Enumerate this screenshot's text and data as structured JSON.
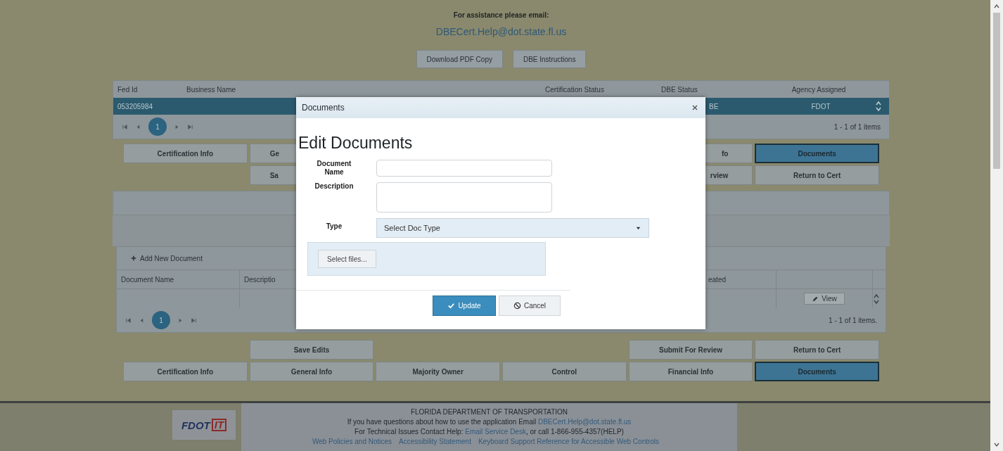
{
  "assistance": {
    "label": "For assistance please email:",
    "email": "DBECert.Help@dot.state.fl.us"
  },
  "top_buttons": [
    "Download PDF Copy",
    "DBE Instructions"
  ],
  "cert_grid": {
    "columns": [
      "Fed Id",
      "Business Name",
      "Certification Status",
      "DBE Status",
      "Agency Assigned"
    ],
    "rows": [
      {
        "fed_id": "053205984",
        "dbe_status": "BE",
        "agency": "FDOT",
        "selected": true
      }
    ],
    "pager": {
      "pages": [
        {
          "label": "1",
          "selected": true
        }
      ],
      "summary": "1 - 1 of 1 items"
    }
  },
  "top_tabs": {
    "left": [
      {
        "label": "Certification Info",
        "selected": false
      },
      {
        "label": "Ge",
        "selected": false
      }
    ],
    "right": [
      {
        "label": "fo",
        "selected": false
      },
      {
        "label": "Documents",
        "selected": true
      }
    ]
  },
  "top_actions": {
    "left": [
      {
        "label": "Sa"
      }
    ],
    "right": [
      {
        "label": "rview"
      },
      {
        "label": "Return to Cert"
      }
    ]
  },
  "documents_grid": {
    "toolbar_button": "Add New Document",
    "columns": [
      "Document Name",
      "Descriptio",
      "eated"
    ],
    "rows": [
      {
        "action": "View"
      }
    ],
    "pager": {
      "pages": [
        {
          "label": "1",
          "selected": true
        }
      ],
      "summary": "1 - 1 of 1 items."
    }
  },
  "bottom_actions": {
    "left": [
      {
        "label": "Save Edits"
      }
    ],
    "right": [
      {
        "label": "Submit For Review"
      },
      {
        "label": "Return to Cert"
      }
    ]
  },
  "bottom_tabs": {
    "left": [
      {
        "label": "Certification Info",
        "selected": false
      },
      {
        "label": "General Info",
        "selected": false
      },
      {
        "label": "Majority Owner",
        "selected": false
      },
      {
        "label": "Control",
        "selected": false
      },
      {
        "label": "Financial Info",
        "selected": false
      },
      {
        "label": "Documents",
        "selected": true
      }
    ]
  },
  "footer": {
    "logo": {
      "text": "FDOT",
      "suffix": "IT"
    },
    "lines": [
      {
        "parts": [
          {
            "text": "FLORIDA DEPARTMENT OF TRANSPORTATION",
            "kind": "text"
          }
        ]
      },
      {
        "parts": [
          {
            "text": "If you have questions about how to use the application Email ",
            "kind": "text"
          },
          {
            "text": "DBECert.Help@dot.state.fl.us",
            "kind": "link"
          }
        ]
      },
      {
        "parts": [
          {
            "text": "For Technical Issues Contact Help: ",
            "kind": "text"
          },
          {
            "text": "Email Service Desk",
            "kind": "link"
          },
          {
            "text": ", or call 1-866-955-4357(HELP)",
            "kind": "text"
          }
        ]
      },
      {
        "parts": [
          {
            "text": "Web Policies and Notices",
            "kind": "link"
          },
          {
            "text": "Accessibility Statement",
            "kind": "link"
          },
          {
            "text": "Keyboard Support Reference for Accessible Web Controls",
            "kind": "link"
          }
        ]
      }
    ]
  },
  "modal": {
    "title": "Documents",
    "heading": "Edit Documents",
    "fields": [
      {
        "label": "Document Name",
        "kind": "text"
      },
      {
        "label": "Description",
        "kind": "textarea"
      },
      {
        "label": "Type",
        "kind": "select",
        "placeholder": "Select Doc Type"
      }
    ],
    "upload_button": "Select files...",
    "buttons": [
      {
        "label": "Update",
        "kind": "primary"
      },
      {
        "label": "Cancel",
        "kind": "cancel"
      }
    ]
  }
}
